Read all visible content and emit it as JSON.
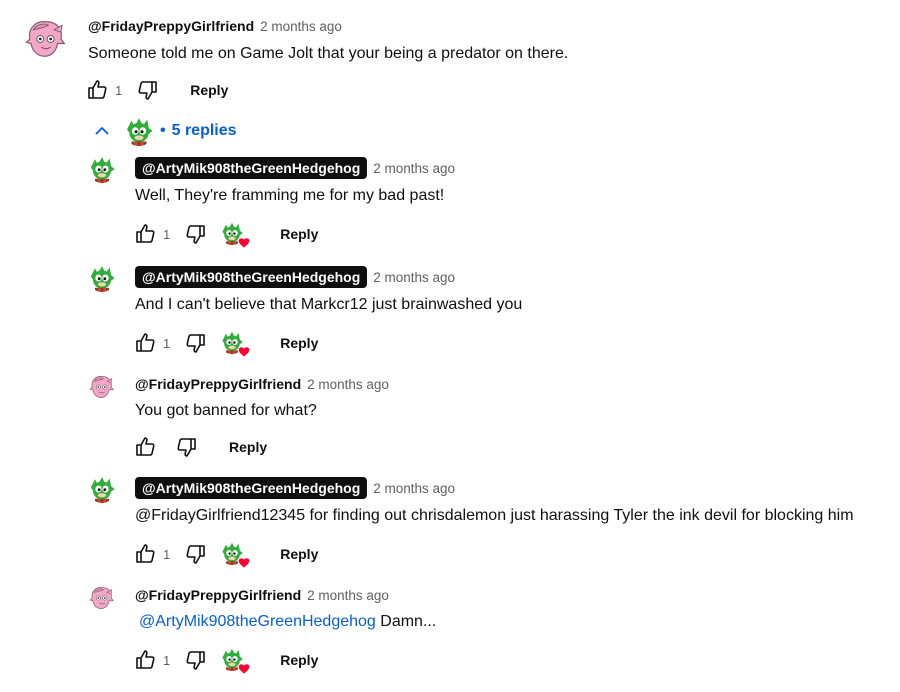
{
  "top_comment": {
    "author": "@FridayPreppyGirlfriend",
    "time": "2 months ago",
    "text": "Someone told me on Game Jolt that your being a predator on there.",
    "likes": "1",
    "reply_label": "Reply"
  },
  "replies_toggle": {
    "bullet": "•",
    "label": "5 replies"
  },
  "replies": [
    {
      "author": "@ArtyMik908theGreenHedgehog",
      "time": "2 months ago",
      "text": "Well, They're framming me for my bad past!",
      "likes": "1",
      "reply_label": "Reply"
    },
    {
      "author": "@ArtyMik908theGreenHedgehog",
      "time": "2 months ago",
      "text": "And I can't believe that Markcr12 just brainwashed you",
      "likes": "1",
      "reply_label": "Reply"
    },
    {
      "author": "@FridayPreppyGirlfriend",
      "time": "2 months ago",
      "text": "You got banned for what?",
      "likes": "",
      "reply_label": "Reply"
    },
    {
      "author": "@ArtyMik908theGreenHedgehog",
      "time": "2 months ago",
      "text": "@FridayGirlfriend12345 for finding out chrisdalemon just harassing Tyler the ink devil for blocking him",
      "likes": "1",
      "reply_label": "Reply"
    },
    {
      "author": "@FridayPreppyGirlfriend",
      "time": "2 months ago",
      "mention": "@ArtyMik908theGreenHedgehog",
      "text": " Damn...",
      "likes": "1",
      "reply_label": "Reply"
    }
  ],
  "icons": {
    "like": "thumbs-up-icon",
    "dislike": "thumbs-down-icon",
    "collapse": "chevron-up-icon",
    "creator_heart": "heart-icon"
  },
  "colors": {
    "link_blue": "#065fd4",
    "muted_gray": "#606060",
    "pill_black": "#0f0f0f",
    "heart_red": "#ff0033",
    "hedgehog_green": "#2fae3a",
    "pink_avatar": "#f4a6c8"
  }
}
